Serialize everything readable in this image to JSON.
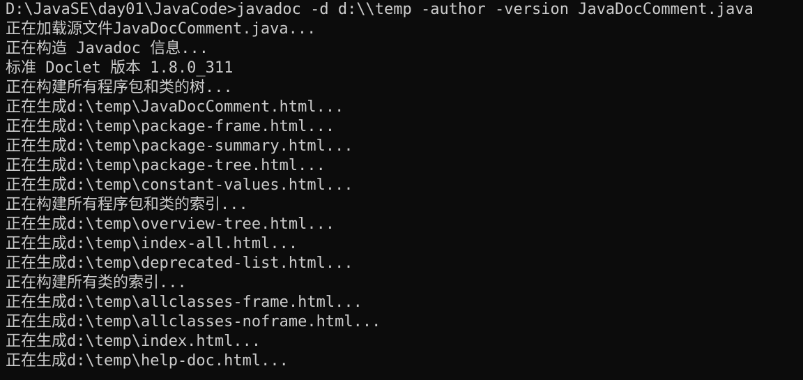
{
  "console": {
    "lines": [
      "D:\\JavaSE\\day01\\JavaCode>javadoc -d d:\\\\temp -author -version JavaDocComment.java",
      "正在加载源文件JavaDocComment.java...",
      "正在构造 Javadoc 信息...",
      "标准 Doclet 版本 1.8.0_311",
      "正在构建所有程序包和类的树...",
      "正在生成d:\\temp\\JavaDocComment.html...",
      "正在生成d:\\temp\\package-frame.html...",
      "正在生成d:\\temp\\package-summary.html...",
      "正在生成d:\\temp\\package-tree.html...",
      "正在生成d:\\temp\\constant-values.html...",
      "正在构建所有程序包和类的索引...",
      "正在生成d:\\temp\\overview-tree.html...",
      "正在生成d:\\temp\\index-all.html...",
      "正在生成d:\\temp\\deprecated-list.html...",
      "正在构建所有类的索引...",
      "正在生成d:\\temp\\allclasses-frame.html...",
      "正在生成d:\\temp\\allclasses-noframe.html...",
      "正在生成d:\\temp\\index.html...",
      "正在生成d:\\temp\\help-doc.html..."
    ]
  },
  "colors": {
    "background": "#0c0c0c",
    "text": "#cccccc"
  }
}
